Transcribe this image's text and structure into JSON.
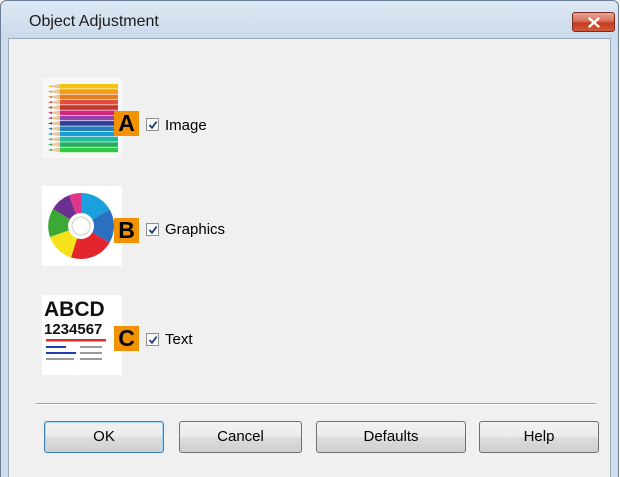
{
  "window": {
    "title": "Object Adjustment"
  },
  "options": [
    {
      "badge": "A",
      "label": "Image",
      "checked": true,
      "thumbnail": "colored-pencils"
    },
    {
      "badge": "B",
      "label": "Graphics",
      "checked": true,
      "thumbnail": "donut-chart"
    },
    {
      "badge": "C",
      "label": "Text",
      "checked": true,
      "thumbnail": "text-sample",
      "thumb_text": {
        "line1": "ABCD",
        "line2": "1234567"
      }
    }
  ],
  "buttons": {
    "ok": "OK",
    "cancel": "Cancel",
    "defaults": "Defaults",
    "help": "Help"
  },
  "colors": {
    "badge": "#f39200",
    "close": "#c8452c",
    "titlebar": "#cfdced"
  }
}
